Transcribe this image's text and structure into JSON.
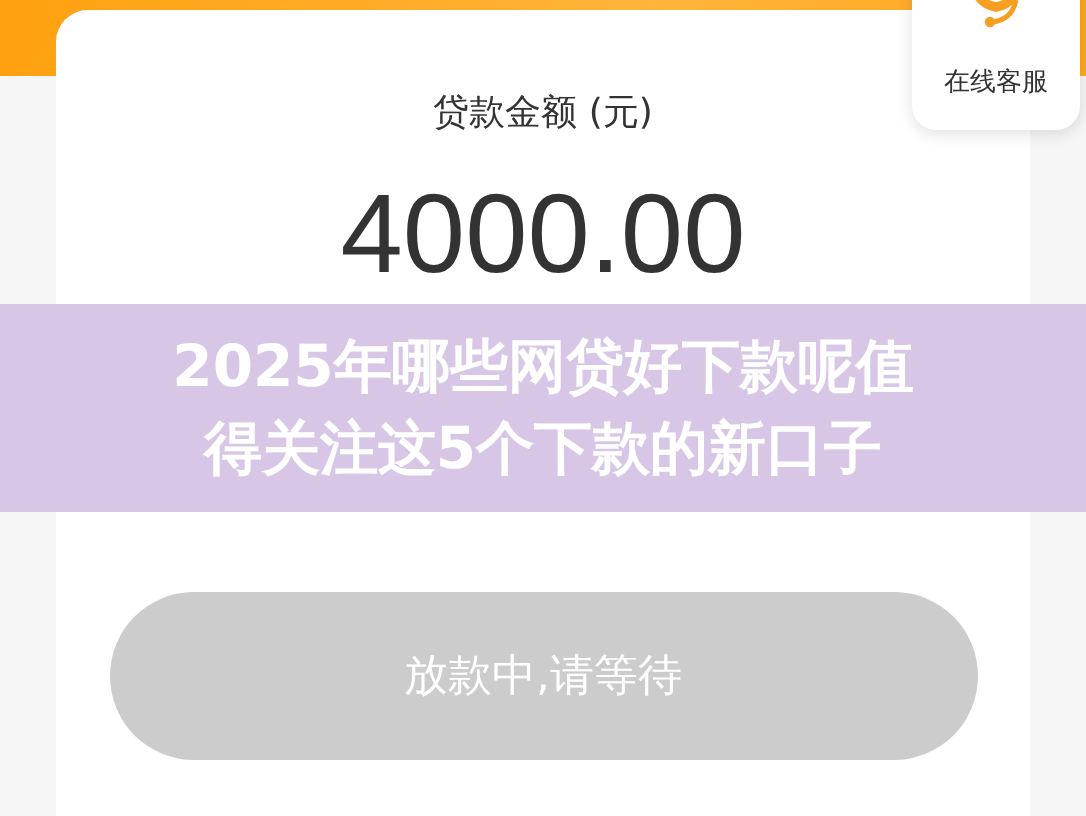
{
  "loan": {
    "label": "贷款金额 (元)",
    "amount": "4000.00"
  },
  "customer_service": {
    "label": "在线客服"
  },
  "banner": {
    "lines": [
      "2025年哪些网贷好下款呢值",
      "得关注这5个下款的新口子"
    ]
  },
  "button": {
    "label": "放款中,请等待",
    "disabled": true
  }
}
